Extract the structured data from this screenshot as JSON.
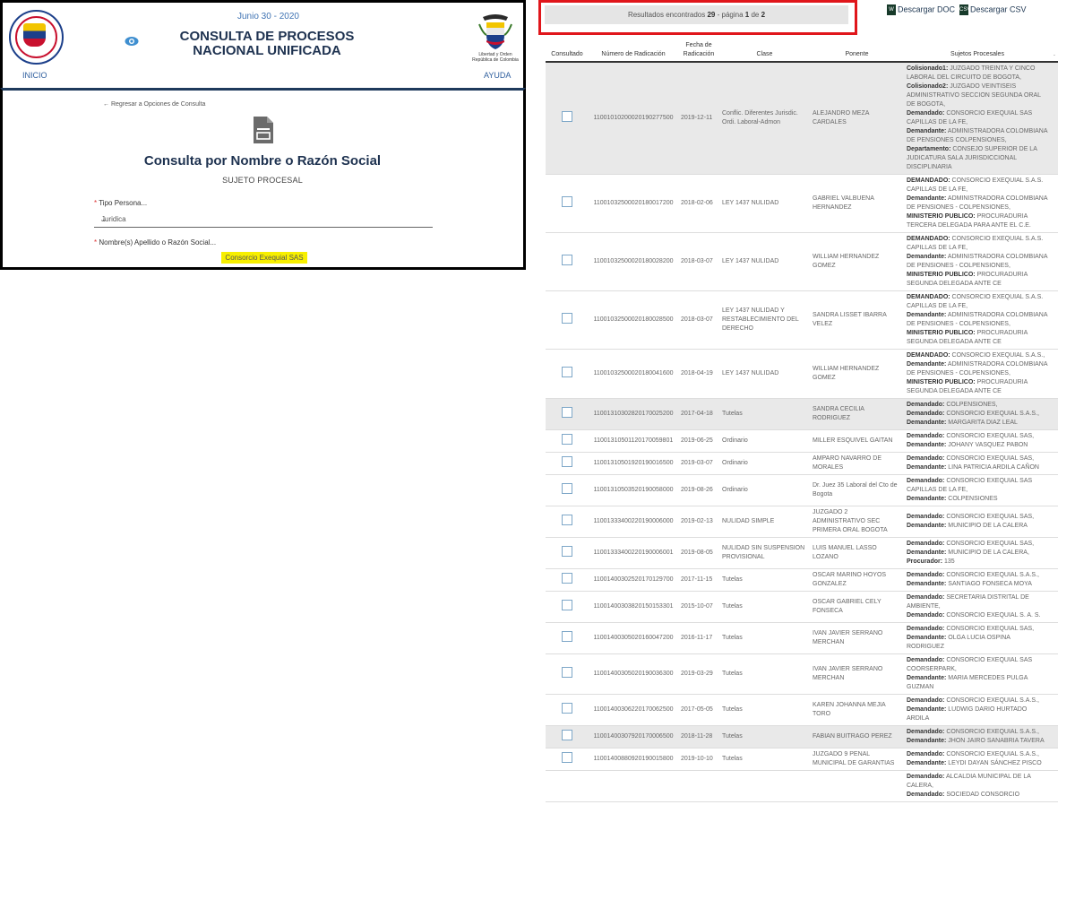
{
  "header": {
    "date": "Junio 30 - 2020",
    "title_line1": "CONSULTA DE PROCESOS",
    "title_line2": "NACIONAL UNIFICADA",
    "home_label": "INICIO",
    "help_label": "AYUDA",
    "seal_text": "RAMA JUDICIAL · REPÚBLICA DE COLOMBIA",
    "shield_text_line1": "Libertad y Orden",
    "shield_text_line2": "República de Colombia",
    "icons": {
      "eye": "eye-icon",
      "seal": "rama-judicial-seal",
      "shield": "colombia-coat-of-arms"
    }
  },
  "form": {
    "back_link": "Regresar a Opciones de Consulta",
    "title": "Consulta por Nombre o Razón Social",
    "subtitle": "SUJETO PROCESAL",
    "tipo_persona_label": "Tipo Persona...",
    "tipo_persona_value": "Juridica",
    "nombre_label": "Nombre(s) Apellido o Razón Social...",
    "nombre_value": "Consorcio Exequial SAS",
    "required_mark": "*"
  },
  "results": {
    "prefix": "Resultados encontrados",
    "count": "29",
    "page_word": "- página",
    "page": "1",
    "of_word": "de",
    "total_pages": "2",
    "download_doc": "Descargar DOC",
    "download_csv": "Descargar CSV",
    "doc_icon_text": "W",
    "csv_icon_text": "CSV",
    "colors": {
      "highlight_border": "#e0161b",
      "row_highlight": "#e9e9e9",
      "link": "#2f6aa8",
      "name_highlight": "#f7ef00"
    }
  },
  "table": {
    "headers": [
      "Consultado",
      "Número de Radicación",
      "Fecha de Radicación",
      "Clase",
      "Ponente",
      "Sujetos Procesales",
      "."
    ],
    "rows": [
      {
        "hl": true,
        "rad": "11001010200020190277500",
        "fecha": "2019-12-11",
        "clase": "Conflic. Diferentes Jurisdic. Ordi. Laboral-Admon",
        "ponente": "ALEJANDRO MEZA CARDALES",
        "sujetos": [
          [
            "Colisionado1:",
            " JUZGADO TREINTA Y CINCO LABORAL DEL CIRCUITO DE BOGOTA,"
          ],
          [
            "Colisionado2:",
            " JUZGADO VEINTISEIS ADMINISTRATIVO SECCION SEGUNDA ORAL DE BOGOTA,"
          ],
          [
            "Demandado:",
            " CONSORCIO EXEQUIAL SAS CAPILLAS DE LA FE,"
          ],
          [
            "Demandante:",
            " ADMINISTRADORA COLOMBIANA DE PENSIONES COLPENSIONES,"
          ],
          [
            "Departamento:",
            " CONSEJO SUPERIOR DE LA JUDICATURA SALA JURISDICCIONAL DISCIPLINARIA"
          ]
        ]
      },
      {
        "hl": false,
        "rad": "11001032500020180017200",
        "fecha": "2018-02-06",
        "clase": "LEY 1437 NULIDAD",
        "ponente": "GABRIEL VALBUENA HERNANDEZ",
        "sujetos": [
          [
            "DEMANDADO:",
            " CONSORCIO EXEQUIAL S.A.S. CAPILLAS DE LA FE,"
          ],
          [
            "Demandante:",
            " ADMINISTRADORA COLOMBIANA DE PENSIONES - COLPENSIONES,"
          ],
          [
            "MINISTERIO PUBLICO:",
            " PROCURADURIA TERCERA DELEGADA PARA ANTE EL C.E."
          ]
        ]
      },
      {
        "hl": false,
        "rad": "11001032500020180028200",
        "fecha": "2018-03-07",
        "clase": "LEY 1437 NULIDAD",
        "ponente": "WILLIAM HERNANDEZ GOMEZ",
        "sujetos": [
          [
            "DEMANDADO:",
            " CONSORCIO EXEQUIAL S.A.S. CAPILLAS DE LA FE,"
          ],
          [
            "Demandante:",
            " ADMINISTRADORA COLOMBIANA DE PENSIONES - COLPENSIONES,"
          ],
          [
            "MINISTERIO PUBLICO:",
            " PROCURADURIA SEGUNDA DELEGADA ANTE CE"
          ]
        ]
      },
      {
        "hl": false,
        "rad": "11001032500020180028500",
        "fecha": "2018-03-07",
        "clase": "LEY 1437 NULIDAD Y RESTABLECIMIENTO DEL DERECHO",
        "ponente": "SANDRA LISSET IBARRA VELEZ",
        "sujetos": [
          [
            "DEMANDADO:",
            " CONSORCIO EXEQUIAL S.A.S. CAPILLAS DE LA FE,"
          ],
          [
            "Demandante:",
            " ADMINISTRADORA COLOMBIANA DE PENSIONES - COLPENSIONES,"
          ],
          [
            "MINISTERIO PUBLICO:",
            " PROCURADURIA SEGUNDA DELEGADA ANTE CE"
          ]
        ]
      },
      {
        "hl": false,
        "rad": "11001032500020180041600",
        "fecha": "2018-04-19",
        "clase": "LEY 1437 NULIDAD",
        "ponente": "WILLIAM HERNANDEZ GOMEZ",
        "sujetos": [
          [
            "DEMANDADO:",
            " CONSORCIO EXEQUIAL S.A.S.,"
          ],
          [
            "Demandante:",
            " ADMINISTRADORA COLOMBIANA DE PENSIONES - COLPENSIONES,"
          ],
          [
            "MINISTERIO PUBLICO:",
            " PROCURADURIA SEGUNDA DELEGADA ANTE CE"
          ]
        ]
      },
      {
        "hl": true,
        "rad": "11001310302820170025200",
        "fecha": "2017-04-18",
        "clase": "Tutelas",
        "ponente": "SANDRA CECILIA RODRIGUEZ",
        "sujetos": [
          [
            "Demandado:",
            " COLPENSIONES,"
          ],
          [
            "Demandado:",
            " CONSORCIO EXEQUIAL S.A.S.,"
          ],
          [
            "Demandante:",
            " MARGARITA DIAZ LEAL"
          ]
        ]
      },
      {
        "hl": false,
        "rad": "11001310501120170059801",
        "fecha": "2019-06-25",
        "clase": "Ordinario",
        "ponente": "MILLER ESQUIVEL GAITAN",
        "sujetos": [
          [
            "Demandado:",
            " CONSORCIO EXEQUIAL SAS,"
          ],
          [
            "Demandante:",
            " JOHANY VASQUEZ PABON"
          ]
        ]
      },
      {
        "hl": false,
        "rad": "11001310501920190016500",
        "fecha": "2019-03-07",
        "clase": "Ordinario",
        "ponente": "AMPARO NAVARRO DE MORALES",
        "sujetos": [
          [
            "Demandado:",
            " CONSORCIO EXEQUIAL SAS,"
          ],
          [
            "Demandante:",
            " LINA PATRICIA ARDILA CAÑON"
          ]
        ]
      },
      {
        "hl": false,
        "rad": "11001310503520190058000",
        "fecha": "2019-08-26",
        "clase": "Ordinario",
        "ponente": "Dr. Juez 35 Laboral del Cto de Bogota",
        "sujetos": [
          [
            "Demandado:",
            " CONSORCIO EXEQUIAL SAS CAPILLAS DE LA FE,"
          ],
          [
            "Demandante:",
            " COLPENSIONES"
          ]
        ]
      },
      {
        "hl": false,
        "rad": "11001333400220190006000",
        "fecha": "2019-02-13",
        "clase": "NULIDAD SIMPLE",
        "ponente": "JUZGADO 2 ADMINISTRATIVO SEC PRIMERA ORAL BOGOTA",
        "sujetos": [
          [
            "Demandado:",
            " CONSORCIO EXEQUIAL SAS,"
          ],
          [
            "Demandante:",
            " MUNICIPIO DE LA CALERA"
          ]
        ]
      },
      {
        "hl": false,
        "rad": "11001333400220190006001",
        "fecha": "2019-08-05",
        "clase": "NULIDAD SIN SUSPENSION PROVISIONAL",
        "ponente": "LUIS MANUEL LASSO LOZANO",
        "sujetos": [
          [
            "Demandado:",
            " CONSORCIO EXEQUIAL SAS,"
          ],
          [
            "Demandante:",
            " MUNICIPIO DE LA CALERA,"
          ],
          [
            "Procurador:",
            " 135"
          ]
        ]
      },
      {
        "hl": false,
        "rad": "11001400302520170129700",
        "fecha": "2017-11-15",
        "clase": "Tutelas",
        "ponente": "OSCAR MARINO HOYOS GONZALEZ",
        "sujetos": [
          [
            "Demandado:",
            " CONSORCIO EXEQUIAL S.A.S.,"
          ],
          [
            "Demandante:",
            " SANTIAGO FONSECA MOYA"
          ]
        ]
      },
      {
        "hl": false,
        "rad": "11001400303820150153301",
        "fecha": "2015-10-07",
        "clase": "Tutelas",
        "ponente": "OSCAR GABRIEL CELY FONSECA",
        "sujetos": [
          [
            "Demandado:",
            " SECRETARIA DISTRITAL DE AMBIENTE,"
          ],
          [
            "Demandado:",
            " CONSORCIO EXEQUIAL S. A. S."
          ]
        ]
      },
      {
        "hl": false,
        "rad": "11001400305020160047200",
        "fecha": "2016-11-17",
        "clase": "Tutelas",
        "ponente": "IVAN JAVIER SERRANO MERCHAN",
        "sujetos": [
          [
            "Demandado:",
            " CONSORCIO EXEQUIAL SAS,"
          ],
          [
            "Demandante:",
            " OLGA LUCIA OSPINA RODRIGUEZ"
          ]
        ]
      },
      {
        "hl": false,
        "rad": "11001400305020190036300",
        "fecha": "2019-03-29",
        "clase": "Tutelas",
        "ponente": "IVAN JAVIER SERRANO MERCHAN",
        "sujetos": [
          [
            "Demandado:",
            " CONSORCIO EXEQUIAL SAS COORSERPARK,"
          ],
          [
            "Demandante:",
            " MARIA MERCEDES PULGA GUZMAN"
          ]
        ]
      },
      {
        "hl": false,
        "rad": "11001400306220170062500",
        "fecha": "2017-05-05",
        "clase": "Tutelas",
        "ponente": "KAREN JOHANNA MEJIA TORO",
        "sujetos": [
          [
            "Demandado:",
            " CONSORCIO EXEQUIAL S.A.S.,"
          ],
          [
            "Demandante:",
            " LUDWIG DARIO HURTADO ARDILA"
          ]
        ]
      },
      {
        "hl": true,
        "rad": "11001400307920170006500",
        "fecha": "2018-11-28",
        "clase": "Tutelas",
        "ponente": "FABIAN BUITRAGO PEREZ",
        "sujetos": [
          [
            "Demandado:",
            " CONSORCIO EXEQUIAL S.A.S.,"
          ],
          [
            "Demandante:",
            " JHON JAIRO SANABRIA TAVERA"
          ]
        ]
      },
      {
        "hl": false,
        "rad": "11001400880920190015800",
        "fecha": "2019-10-10",
        "clase": "Tutelas",
        "ponente": "JUZGADO 9 PENAL MUNICIPAL DE GARANTIAS",
        "sujetos": [
          [
            "Demandado:",
            " CONSORCIO EXEQUIAL S.A.S.,"
          ],
          [
            "Demandante:",
            " LEYDI DAYAN SÁNCHEZ PISCO"
          ]
        ]
      },
      {
        "hl": false,
        "rad": "",
        "fecha": "",
        "clase": "",
        "ponente": "",
        "nochk": true,
        "sujetos": [
          [
            "Demandado:",
            " ALCALDIA MUNICIPAL DE LA CALERA,"
          ],
          [
            "Demandado:",
            " SOCIEDAD CONSORCIO"
          ]
        ]
      }
    ]
  }
}
